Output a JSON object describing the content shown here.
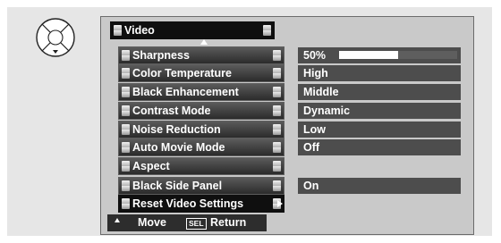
{
  "menu": {
    "title": "Video",
    "items": [
      {
        "label": "Sharpness",
        "value": "50%"
      },
      {
        "label": "Color Temperature",
        "value": "High"
      },
      {
        "label": "Black Enhancement",
        "value": "Middle"
      },
      {
        "label": "Contrast Mode",
        "value": "Dynamic"
      },
      {
        "label": "Noise Reduction",
        "value": "Low"
      },
      {
        "label": "Auto Movie Mode",
        "value": "Off"
      },
      {
        "label": "Aspect",
        "value": ""
      },
      {
        "label": "Black Side Panel",
        "value": "On"
      },
      {
        "label": "Reset Video Settings",
        "value": ""
      }
    ],
    "selected_index": 8,
    "sharpness_level": 0.5
  },
  "footer": {
    "move_label": "Move",
    "sel_key": "SEL",
    "return_label": "Return"
  },
  "icons": {
    "dpad": "dpad-icon",
    "up_arrow": "up-arrow-icon",
    "right_arrow": "right-arrow-icon"
  },
  "colors": {
    "panel": "#e6e6e6",
    "menu_bg": "#c9c9c9",
    "value_bg": "#4d4d4d",
    "selected_bg": "#0f0f0f"
  }
}
